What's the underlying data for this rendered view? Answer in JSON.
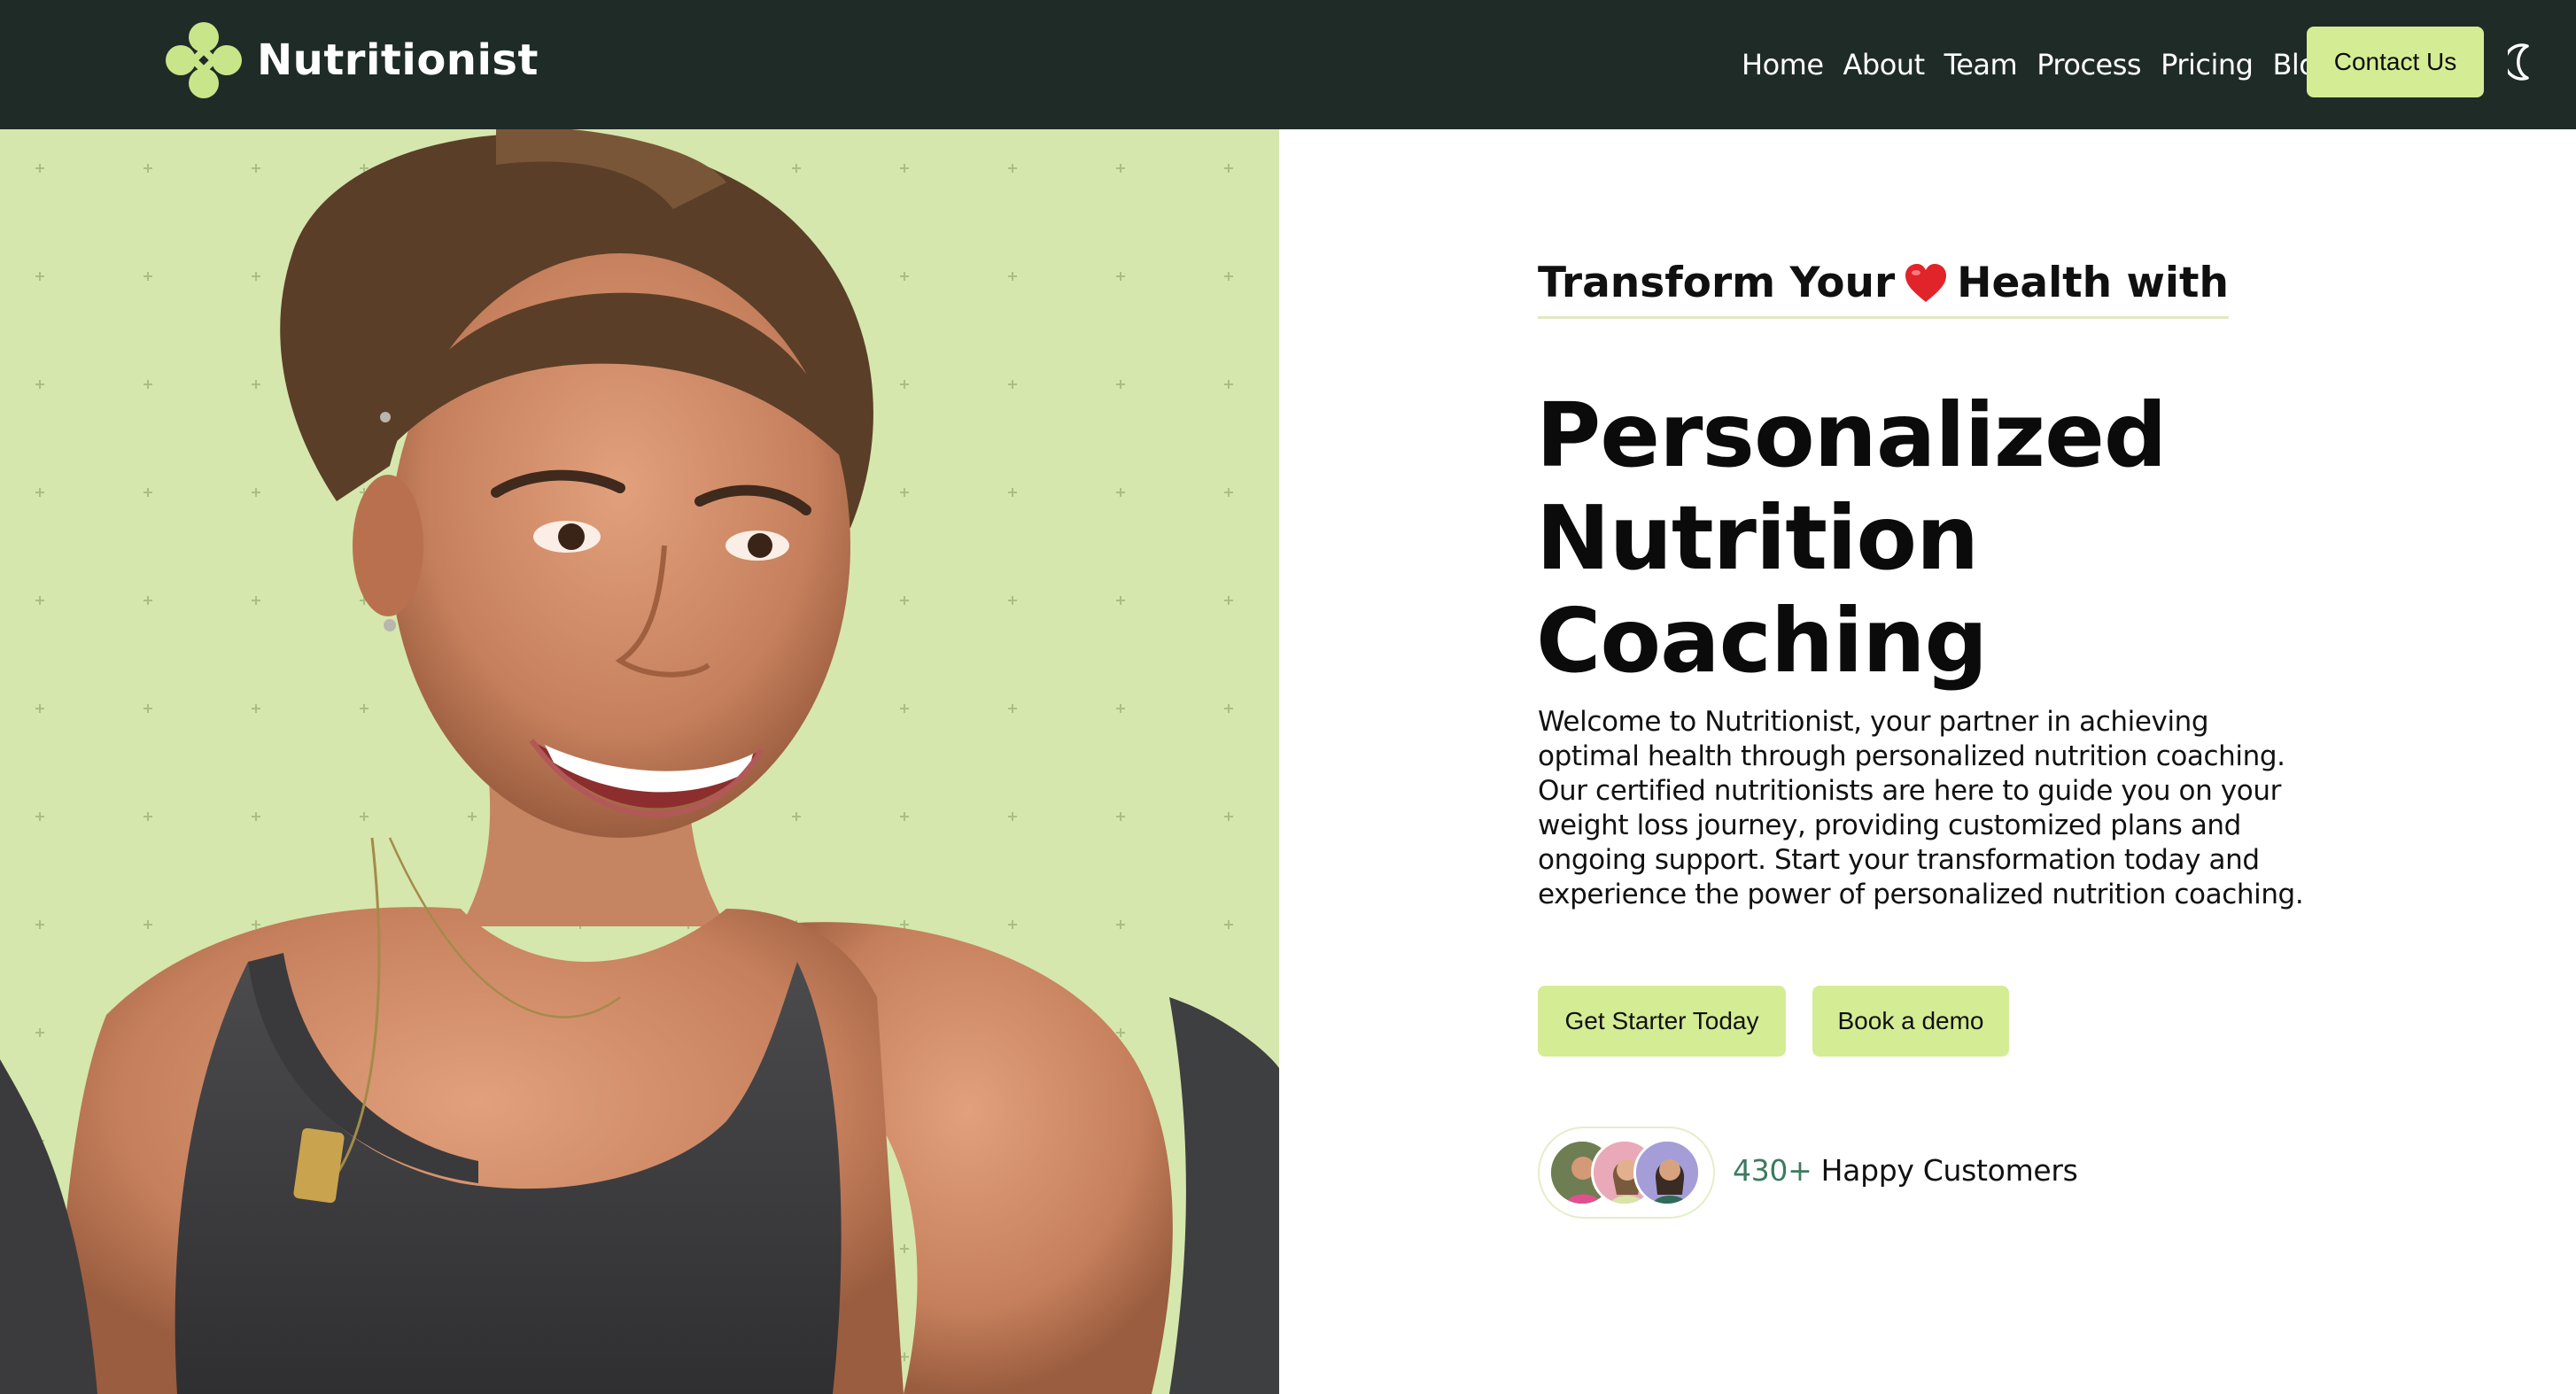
{
  "brand": {
    "name": "Nutritionist"
  },
  "nav": {
    "links": [
      "Home",
      "About",
      "Team",
      "Process",
      "Pricing",
      "Blog"
    ],
    "contact_label": "Contact Us",
    "theme_icon": "moon-icon"
  },
  "hero": {
    "eyebrow_before": "Transform Your",
    "eyebrow_after": "Health with",
    "eyebrow_icon": "heart-icon",
    "headline_line1": "Personalized",
    "headline_line2": "Nutrition Coaching",
    "description": "Welcome to Nutritionist, your partner in achieving optimal health through personalized nutrition coaching. Our certified nutritionists are here to guide you on your weight loss journey, providing customized plans and ongoing support. Start your transformation today and experience the power of personalized nutrition coaching.",
    "cta_primary": "Get Starter Today",
    "cta_secondary": "Book a demo",
    "customers_count": "430+",
    "customers_label": "Happy Customers"
  },
  "colors": {
    "header_bg": "#1f2b26",
    "accent": "#d4ec94",
    "hero_image_bg": "#d5e7ad",
    "count_color": "#3c7a5e"
  }
}
